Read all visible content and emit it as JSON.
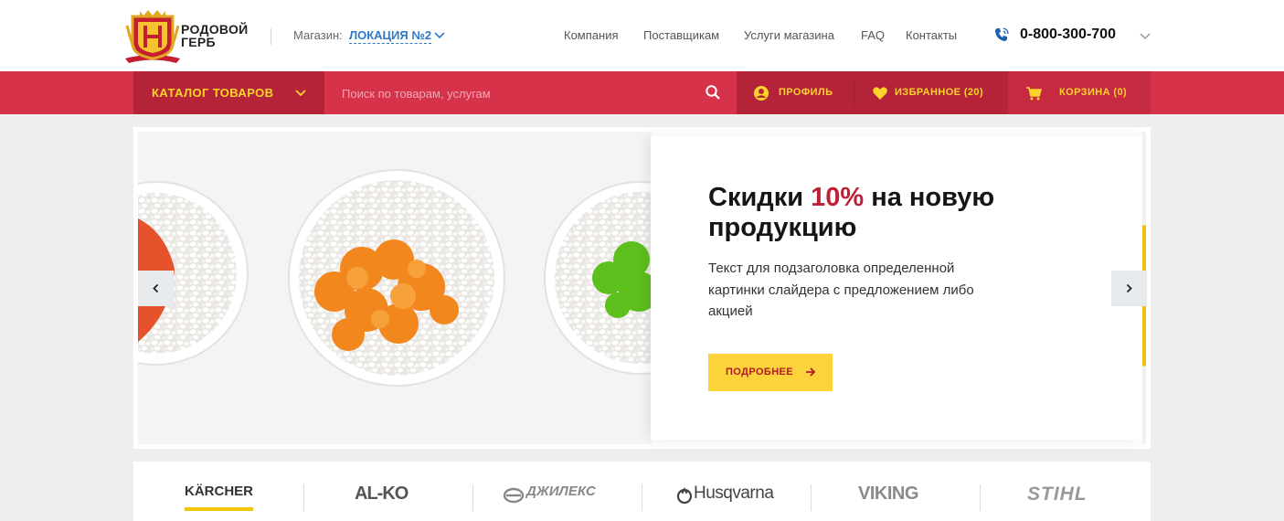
{
  "header": {
    "logo_text_line1": "РОДОВОЙ",
    "logo_text_line2": "ГЕРБ",
    "store_label": "Магазин:",
    "store_value": "ЛОКАЦИЯ №2",
    "nav": [
      "Компания",
      "Поставщикам",
      "Услуги магазина",
      "FAQ",
      "Контакты"
    ],
    "phone": "0-800-300-700"
  },
  "toolbar": {
    "catalog_label": "КАТАЛОГ ТОВАРОВ",
    "search_placeholder": "Поиск по товарам, услугам",
    "profile_label": "ПРОФИЛЬ",
    "favorites_label": "ИЗБРАННОЕ (20)",
    "cart_label": "КОРЗИНА (0)"
  },
  "slider": {
    "title_part1": "Скидки ",
    "title_highlight": "10%",
    "title_part2": " на новую продукцию",
    "text": "Текст для подзаголовка определенной картинки слайдера с предложением либо акцией",
    "button_label": "ПОДРОБНЕЕ"
  },
  "brands": [
    "KÄRCHER",
    "AL-KO",
    "ДЖИЛЕКС",
    "Husqvarna",
    "VIKING",
    "STIHL"
  ],
  "colors": {
    "accent_red": "#d6334b",
    "dark_red": "#b52338",
    "yellow": "#fbd42b",
    "link_blue": "#2e79c7"
  }
}
